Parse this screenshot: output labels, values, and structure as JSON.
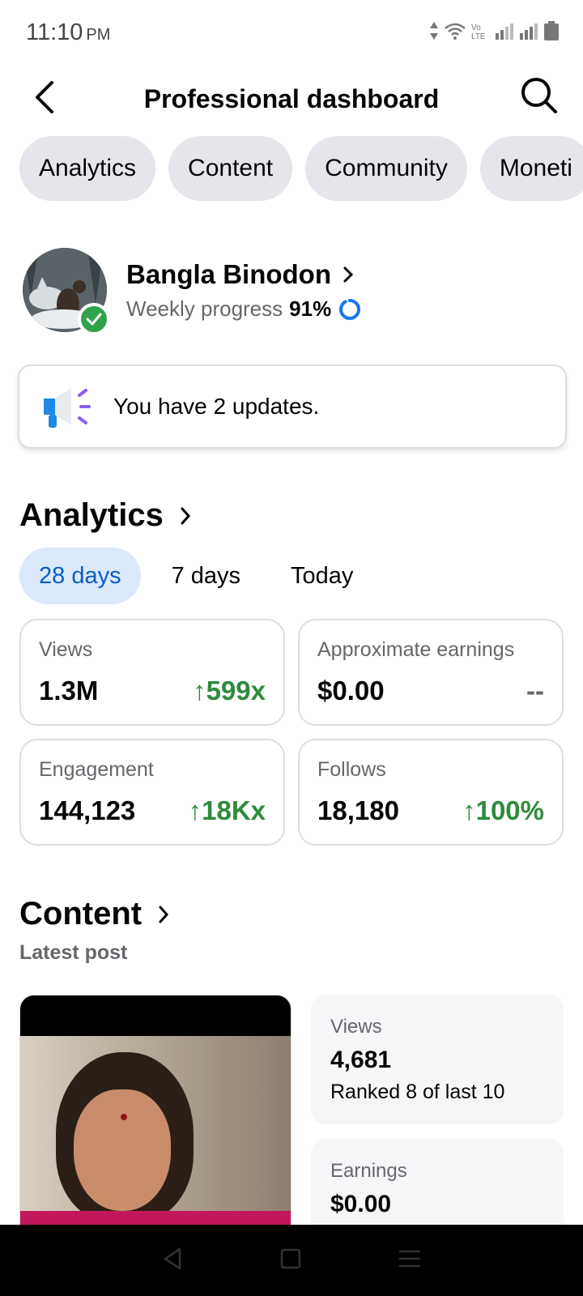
{
  "status_bar": {
    "time": "11:10",
    "ampm": "PM"
  },
  "header": {
    "title": "Professional dashboard"
  },
  "chips": [
    {
      "label": "Analytics"
    },
    {
      "label": "Content"
    },
    {
      "label": "Community"
    },
    {
      "label": "Moneti"
    }
  ],
  "profile": {
    "name": "Bangla Binodon",
    "progress_label": "Weekly progress",
    "progress_value": "91%",
    "progress_fraction": 0.91
  },
  "updates": {
    "text": "You have 2 updates."
  },
  "analytics": {
    "title": "Analytics",
    "ranges": [
      {
        "label": "28 days",
        "active": true
      },
      {
        "label": "7 days",
        "active": false
      },
      {
        "label": "Today",
        "active": false
      }
    ],
    "stats": [
      {
        "label": "Views",
        "value": "1.3M",
        "change": "599x",
        "trend": "up"
      },
      {
        "label": "Approximate earnings",
        "value": "$0.00",
        "change": "--",
        "trend": "none"
      },
      {
        "label": "Engagement",
        "value": "144,123",
        "change": "18Kx",
        "trend": "up"
      },
      {
        "label": "Follows",
        "value": "18,180",
        "change": "100%",
        "trend": "up"
      }
    ]
  },
  "content": {
    "title": "Content",
    "subtitle": "Latest post",
    "views_label": "Views",
    "views_value": "4,681",
    "rank_text": "Ranked 8 of last 10",
    "earnings_label": "Earnings",
    "earnings_value": "$0.00"
  },
  "colors": {
    "accent_blue": "#0a5dc2",
    "positive_green": "#2e8b3c",
    "chip_bg": "#e4e6eb",
    "verified_green": "#31a24c"
  }
}
